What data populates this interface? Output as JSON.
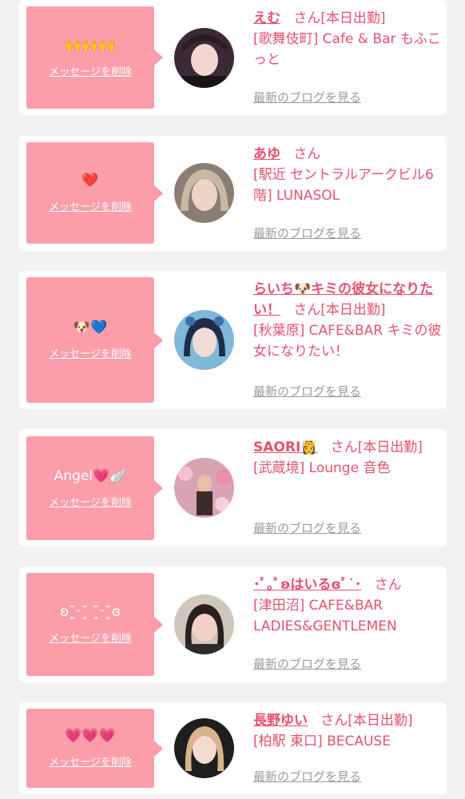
{
  "common": {
    "delete_label": "メッセージを削除",
    "blog_label": "最新のブログを見る",
    "accent_color": "#fc9daa",
    "text_color": "#e8506e"
  },
  "cards": [
    {
      "message": "🙌🙌🙌",
      "name": "えむ",
      "suffix": "さん[本日出勤]",
      "shop": "[歌舞伎町] Cafe & Bar もふこっと"
    },
    {
      "message": "❤️",
      "name": "あゆ",
      "suffix": "さん",
      "shop": "[駅近 セントラルアークビル6階] LUNASOL"
    },
    {
      "message": "🐶💙",
      "name": "らいち🐶キミの彼女になりたい！",
      "suffix": "さん[本日出勤]",
      "shop": "[秋葉原] CAFE&BAR キミの彼女になりたい！"
    },
    {
      "message": "Angel💗🪽",
      "name": "SAORI👸",
      "suffix": "さん[本日出勤]",
      "shop": "[武蔵境] Lounge 音色"
    },
    {
      "message": "ʚ˘͈ᵕ˘͈ ˘͈ᵕ˘͈ɞ",
      "name": "･ﾟ｡ﾟʚはいるɞﾟ˙･",
      "suffix": "さん",
      "shop": "[津田沼] CAFE&BAR LADIES&GENTLEMEN"
    },
    {
      "message": "💗💗💗",
      "name": "長野ゆい",
      "suffix": "さん[本日出勤]",
      "shop": "[柏駅 東口] BECAUSE"
    }
  ]
}
